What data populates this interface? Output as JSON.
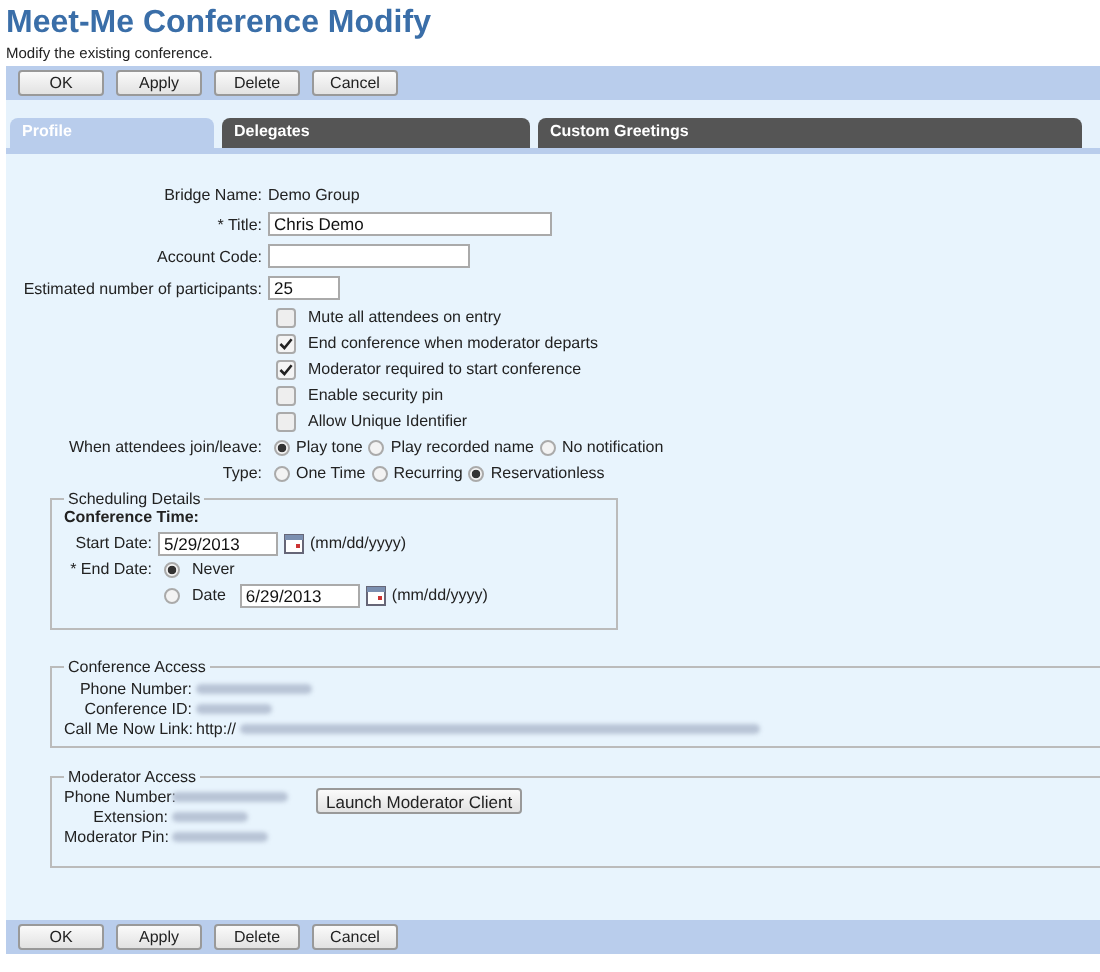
{
  "page": {
    "title": "Meet-Me Conference Modify",
    "subtitle": "Modify the existing conference."
  },
  "top_buttons": [
    "OK",
    "Apply",
    "Delete",
    "Cancel"
  ],
  "tabs": [
    {
      "label": "Profile",
      "selected": true
    },
    {
      "label": "Delegates",
      "selected": false
    },
    {
      "label": "Custom Greetings",
      "selected": false
    }
  ],
  "form": {
    "bridge_name": {
      "label": "Bridge Name:",
      "value": "Demo Group"
    },
    "title": {
      "label": "* Title:",
      "value": "Chris Demo"
    },
    "account_code": {
      "label": "Account Code:"
    },
    "participants": {
      "label": "Estimated number of participants:",
      "value": "25"
    },
    "options": [
      {
        "label": "Mute all attendees on entry",
        "checked": false
      },
      {
        "label": "End conference when moderator departs",
        "checked": true
      },
      {
        "label": "Moderator required to start conference",
        "checked": true
      },
      {
        "label": "Enable security pin",
        "checked": false
      },
      {
        "label": "Allow Unique Identifier",
        "checked": false
      }
    ],
    "radio_groups": [
      {
        "label": "When attendees join/leave:",
        "options": [
          {
            "label": "Play tone",
            "selected": true
          },
          {
            "label": "Play recorded name",
            "selected": false
          },
          {
            "label": "No notification",
            "selected": false
          }
        ]
      },
      {
        "label": "Type:",
        "options": [
          {
            "label": "One Time",
            "selected": false
          },
          {
            "label": "Recurring",
            "selected": false
          },
          {
            "label": "Reservationless",
            "selected": true
          }
        ]
      }
    ]
  },
  "scheduling": {
    "legend": "Scheduling Details",
    "heading": "Conference Time:",
    "start_label": "Start Date:",
    "start_value": "5/29/2013",
    "start_hint": "(mm/dd/yyyy)",
    "end_label": "* End Date:",
    "end_options": [
      {
        "label": "Never",
        "selected": true
      },
      {
        "label": "Date",
        "selected": false
      }
    ],
    "end_value": "6/29/2013",
    "end_hint": "(mm/dd/yyyy)"
  },
  "conference_access": {
    "legend": "Conference Access",
    "fields": [
      {
        "label": "Phone Number:",
        "kind": "redacted"
      },
      {
        "label": "Conference ID:",
        "kind": "redacted"
      },
      {
        "label": "Call Me Now Link:",
        "kind": "link",
        "value": "http://"
      }
    ]
  },
  "moderator_access": {
    "legend": "Moderator Access",
    "button": "Launch Moderator Client",
    "fields": [
      {
        "label": "Phone Number:",
        "kind": "redacted"
      },
      {
        "label": "Extension:",
        "kind": "redacted"
      },
      {
        "label": "Moderator Pin:",
        "kind": "redacted"
      }
    ]
  },
  "bottom_buttons": [
    "OK",
    "Apply",
    "Delete",
    "Cancel"
  ]
}
